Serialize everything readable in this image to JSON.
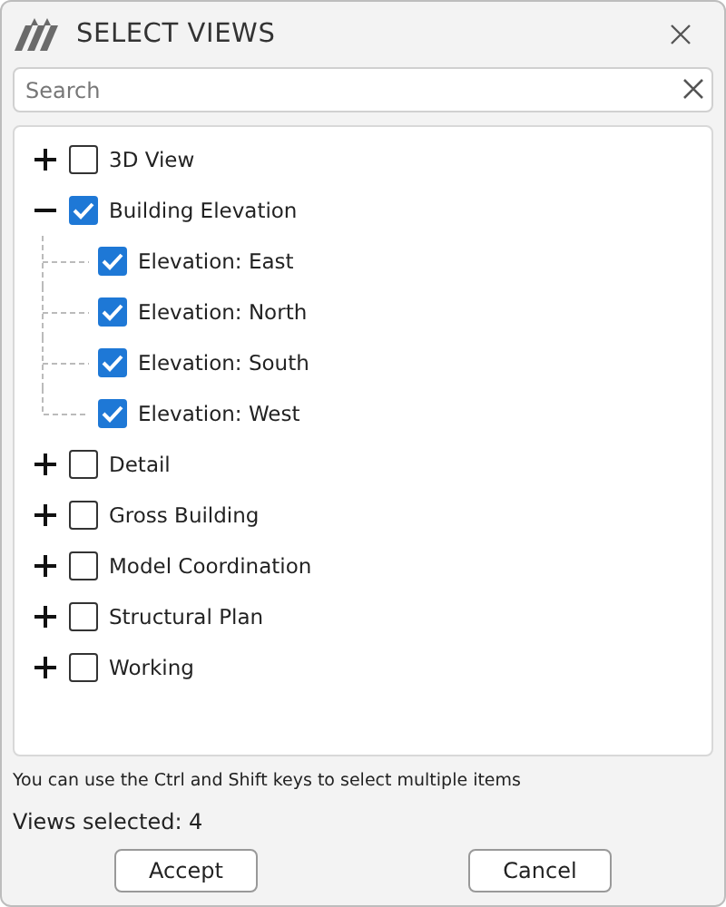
{
  "window": {
    "title": "SELECT VIEWS"
  },
  "search": {
    "placeholder": "Search"
  },
  "tree": [
    {
      "label": "3D View",
      "expanded": false,
      "checked": false
    },
    {
      "label": "Building Elevation",
      "expanded": true,
      "checked": true,
      "children": [
        {
          "label": "Elevation: East",
          "checked": true
        },
        {
          "label": "Elevation: North",
          "checked": true
        },
        {
          "label": "Elevation: South",
          "checked": true
        },
        {
          "label": "Elevation: West",
          "checked": true
        }
      ]
    },
    {
      "label": "Detail",
      "expanded": false,
      "checked": false
    },
    {
      "label": "Gross Building",
      "expanded": false,
      "checked": false
    },
    {
      "label": "Model Coordination",
      "expanded": false,
      "checked": false
    },
    {
      "label": "Structural Plan",
      "expanded": false,
      "checked": false
    },
    {
      "label": "Working",
      "expanded": false,
      "checked": false
    }
  ],
  "hint": "You can use the Ctrl and Shift keys to select multiple items",
  "status": "Views selected: 4",
  "buttons": [
    "Accept",
    "Cancel"
  ]
}
